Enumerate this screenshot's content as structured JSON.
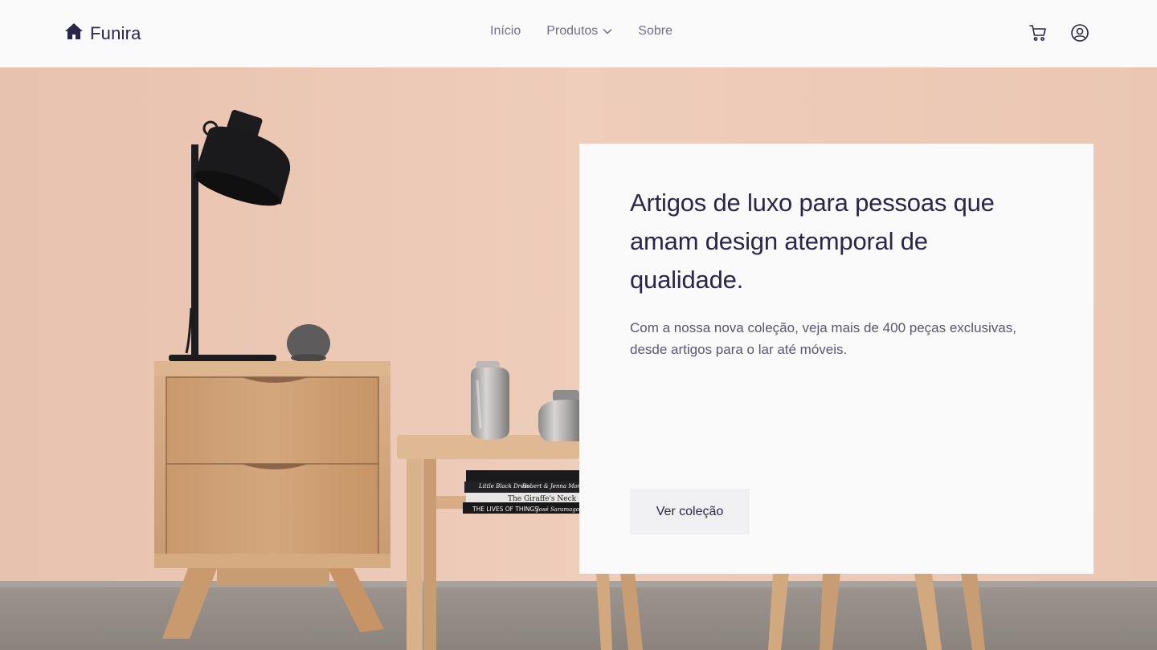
{
  "brand": {
    "name": "Funira",
    "logo_icon": "home-icon",
    "color": "#2a254b"
  },
  "nav": {
    "items": [
      {
        "label": "Início"
      },
      {
        "label": "Produtos",
        "icon": "chevron-down-icon"
      },
      {
        "label": "Sobre"
      }
    ],
    "link_color": "#726e8d"
  },
  "actions": {
    "cart_icon": "cart-icon",
    "account_icon": "user-circle-icon"
  },
  "hero": {
    "title": "Artigos de luxo para pessoas que amam design atemporal de qualidade.",
    "description": "Com a nossa nova coleção, veja mais de 400 peças exclusivas, desde artigos para o lar até móveis.",
    "cta_label": "Ver coleção",
    "books": [
      "Little Black Dress",
      "Robert & Jenna Morgan",
      "The Giraffe's Neck",
      "THE LIVES OF THINGS",
      "José Saramago"
    ]
  },
  "colors": {
    "background": "#fafafa",
    "wall": "#efcfbd",
    "accent": "#2a254b"
  }
}
